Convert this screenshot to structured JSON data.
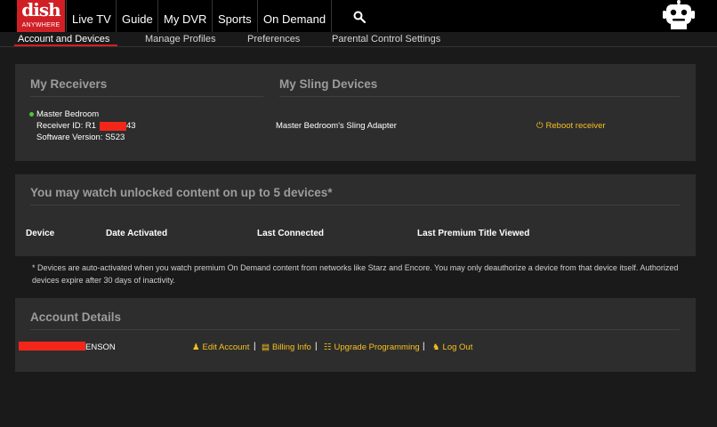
{
  "logo": {
    "word": "dish",
    "sub": "ANYWHERE"
  },
  "nav": [
    {
      "label": "Live TV"
    },
    {
      "label": "Guide"
    },
    {
      "label": "My DVR"
    },
    {
      "label": "Sports"
    },
    {
      "label": "On Demand"
    }
  ],
  "subnav": [
    {
      "label": "Account and Devices"
    },
    {
      "label": "Manage Profiles"
    },
    {
      "label": "Preferences"
    },
    {
      "label": "Parental Control Settings"
    }
  ],
  "receivers": {
    "title": "My Receivers",
    "name": "Master Bedroom",
    "receiver_id_prefix": "Receiver ID: R1",
    "receiver_id_suffix": "43",
    "software_version": "Software Version: S523"
  },
  "sling": {
    "title": "My Sling Devices",
    "device": "Master Bedroom's Sling Adapter",
    "reboot_label": "Reboot receiver"
  },
  "devices": {
    "title": "You may watch unlocked content on up to 5 devices*",
    "columns": [
      "Device",
      "Date Activated",
      "Last Connected",
      "Last Premium Title Viewed"
    ],
    "note": "* Devices are auto-activated when you watch premium On Demand content from networks like Starz and Encore. You may only deauthorize a device from that device itself. Authorized devices expire after 30 days of inactivity."
  },
  "account": {
    "title": "Account Details",
    "name_suffix": "ENSON",
    "links": [
      {
        "label": "Edit Account",
        "icon": "user-icon"
      },
      {
        "label": "Billing Info",
        "icon": "document-icon"
      },
      {
        "label": "Upgrade Programming",
        "icon": "cart-icon"
      },
      {
        "label": "Log Out",
        "icon": "logout-icon"
      }
    ],
    "separator": "|"
  },
  "colors": {
    "brand_red": "#d11f26",
    "link_yellow": "#f6c11f",
    "status_green": "#54c23a",
    "panel_bg": "#2d2d2d"
  }
}
